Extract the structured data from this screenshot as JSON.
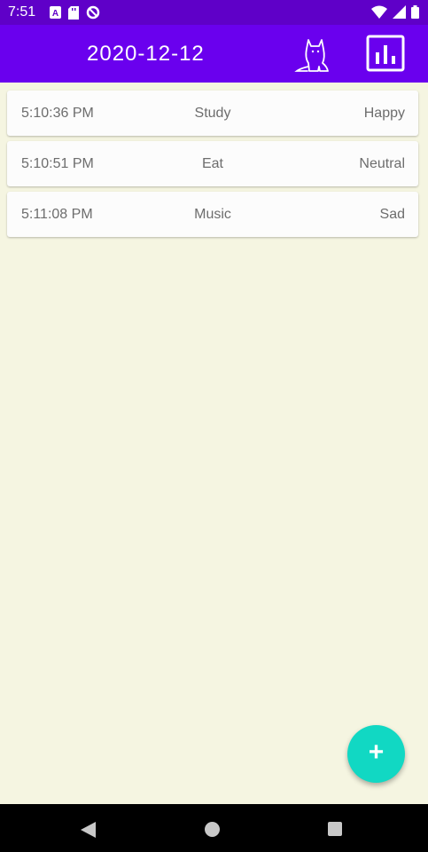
{
  "status_bar": {
    "time": "7:51",
    "left_icons": [
      "a-text-icon",
      "sd-card-icon",
      "data-saver-icon"
    ],
    "right_icons": [
      "wifi-icon",
      "signal-icon",
      "battery-icon"
    ]
  },
  "app_bar": {
    "title": "2020-12-12",
    "actions": [
      "cat-icon",
      "bar-chart-icon"
    ]
  },
  "entries": [
    {
      "time": "5:10:36 PM",
      "activity": "Study",
      "mood": "Happy"
    },
    {
      "time": "5:10:51 PM",
      "activity": "Eat",
      "mood": "Neutral"
    },
    {
      "time": "5:11:08 PM",
      "activity": "Music",
      "mood": "Sad"
    }
  ],
  "fab": {
    "icon": "plus-icon",
    "label": "+"
  },
  "colors": {
    "status_bar": "#5f00c8",
    "app_bar": "#6a00ee",
    "background": "#f5f5e1",
    "fab": "#11d8c3",
    "card": "#fcfcfc"
  }
}
